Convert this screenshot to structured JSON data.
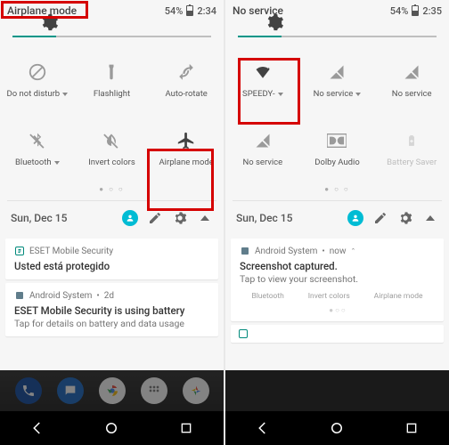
{
  "left": {
    "status": {
      "title": "Airplane mode",
      "battery": "54%",
      "time": "2:34"
    },
    "tiles_row1": [
      {
        "label": "Do not disturb",
        "caret": true
      },
      {
        "label": "Flashlight",
        "caret": false
      },
      {
        "label": "Auto-rotate",
        "caret": false
      }
    ],
    "tiles_row2": [
      {
        "label": "Bluetooth",
        "caret": true
      },
      {
        "label": "Invert colors",
        "caret": false
      },
      {
        "label": "Airplane mode",
        "caret": false
      }
    ],
    "date": "Sun, Dec 15",
    "notif1": {
      "app": "ESET Mobile Security",
      "title": "Usted está protegido"
    },
    "notif2": {
      "app": "Android System",
      "meta": "2d",
      "title": "ESET Mobile Security is using battery",
      "body": "Tap for details on battery and data usage"
    }
  },
  "right": {
    "status": {
      "title": "No service",
      "battery": "54%",
      "time": "2:35"
    },
    "tiles_row1": [
      {
        "label": "SPEEDY-",
        "caret": true
      },
      {
        "label": "No service",
        "caret": true
      },
      {
        "label": "No service",
        "caret": false
      }
    ],
    "tiles_row2": [
      {
        "label": "No service",
        "caret": false
      },
      {
        "label": "Dolby Audio",
        "caret": false
      },
      {
        "label": "Battery Saver",
        "caret": false,
        "disabled": true
      }
    ],
    "date": "Sun, Dec 15",
    "notif1": {
      "app": "Android System",
      "meta": "now",
      "title": "Screenshot captured.",
      "body": "Tap to view your screenshot."
    },
    "sub_labels": {
      "a": "Bluetooth",
      "b": "Invert colors",
      "c": "Airplane mode"
    }
  }
}
